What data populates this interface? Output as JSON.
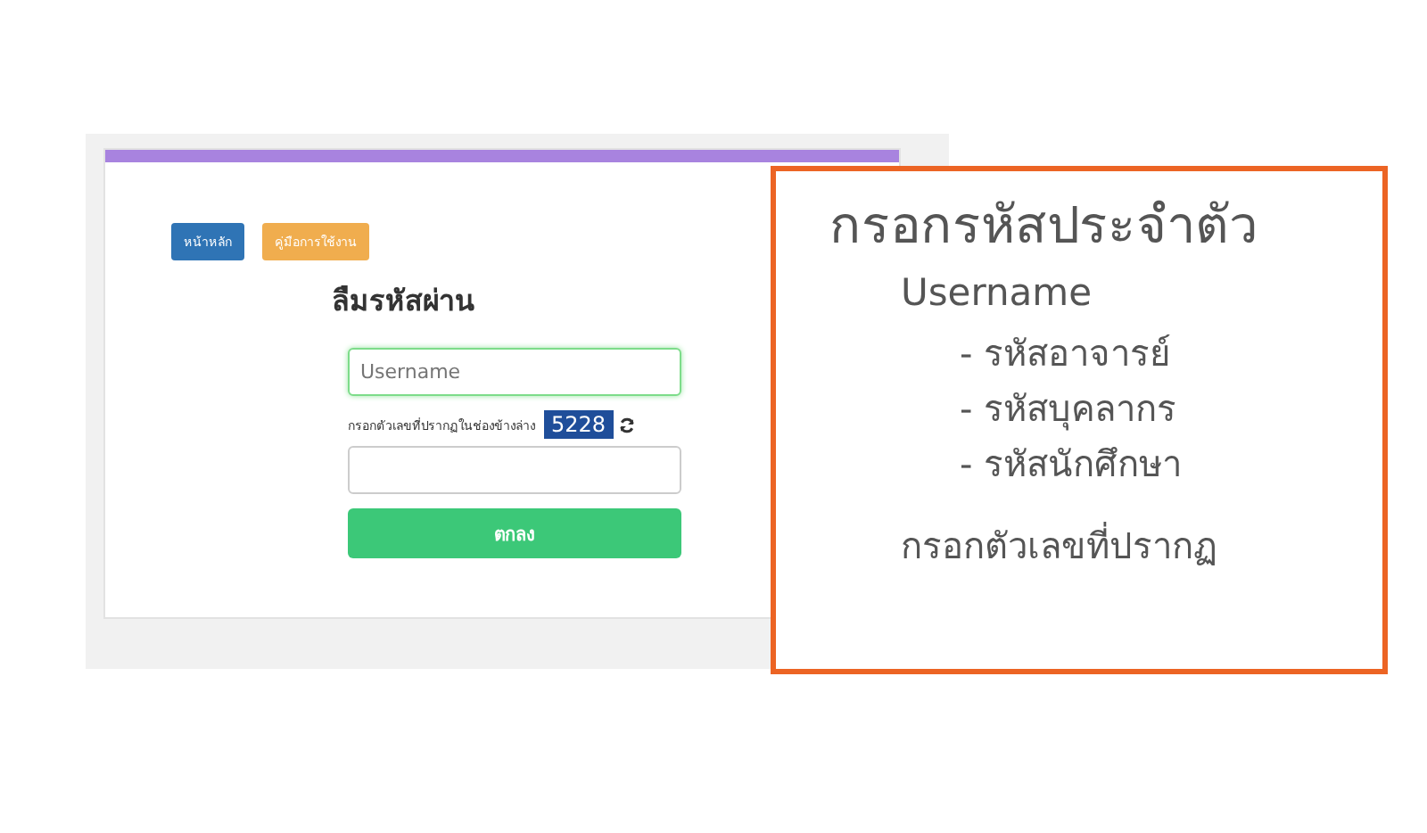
{
  "page": {
    "nav_buttons": [
      {
        "label": "หน้าหลัก",
        "kind": "primary"
      },
      {
        "label": "คู่มือการใช้งาน",
        "kind": "warning"
      }
    ],
    "title": "ลืมรหัสผ่าน",
    "username_field": {
      "placeholder": "Username",
      "focused": true
    },
    "captcha": {
      "label": "กรอกตัวเลขที่ปรากฏในช่องข้างล่าง",
      "code": "5228"
    },
    "submit": "ตกลง"
  },
  "callout": {
    "heading": "กรอกรหัสประจำตัว",
    "subheading": "Username",
    "items": [
      "- รหัสอาจารย์",
      "- รหัสบุคลากร",
      "- รหัสนักศึกษา"
    ],
    "footer": "กรอกตัวเลขที่ปรากฏ"
  }
}
